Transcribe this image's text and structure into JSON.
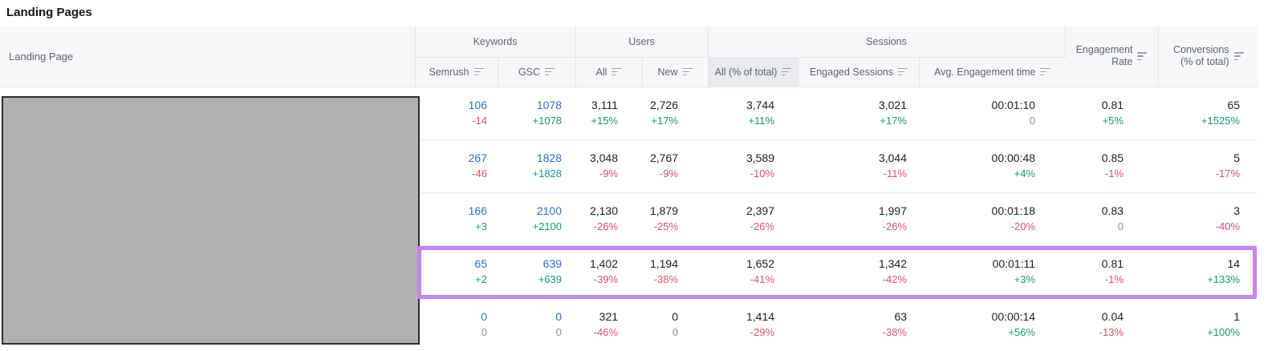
{
  "page": {
    "title": "Landing Pages"
  },
  "colors": {
    "link_blue": "#2d6ee0",
    "positive_green": "#17997e",
    "negative_red": "#e14f6d",
    "neutral_gray": "#8d939c",
    "highlight_purple": "#c385f3",
    "header_bg": "#f7f8fa",
    "selected_header_bg": "#e8eaef",
    "redaction_gray": "#b1b1b1"
  },
  "header": {
    "landing_page": "Landing Page",
    "groups": {
      "keywords": "Keywords",
      "users": "Users",
      "sessions": "Sessions"
    },
    "subcols": {
      "semrush": "Semrush",
      "gsc": "GSC",
      "users_all": "All",
      "users_new": "New",
      "sessions_all": "All (% of total)",
      "engaged": "Engaged Sessions",
      "avg_time": "Avg. Engagement time"
    },
    "engagement_rate": {
      "line1": "Engagement",
      "line2": "Rate"
    },
    "conversions": {
      "line1": "Conversions",
      "line2": "(% of total)"
    },
    "sorted_column": "All (% of total)"
  },
  "table": {
    "column_keys": [
      "semrush",
      "gsc",
      "users_all",
      "users_new",
      "sessions_all",
      "engaged",
      "avg_time",
      "rate",
      "conv"
    ],
    "rows": [
      {
        "highlighted": false,
        "cells": [
          {
            "value": "106",
            "delta": "-14",
            "value_style": "link",
            "delta_style": "neg"
          },
          {
            "value": "1078",
            "delta": "+1078",
            "value_style": "link",
            "delta_style": "pos"
          },
          {
            "value": "3,111",
            "delta": "+15%",
            "delta_style": "pos"
          },
          {
            "value": "2,726",
            "delta": "+17%",
            "delta_style": "pos"
          },
          {
            "value": "3,744",
            "delta": "+11%",
            "delta_style": "pos"
          },
          {
            "value": "3,021",
            "delta": "+17%",
            "delta_style": "pos"
          },
          {
            "value": "00:01:10",
            "delta": "0",
            "delta_style": "neutral"
          },
          {
            "value": "0.81",
            "delta": "+5%",
            "delta_style": "pos"
          },
          {
            "value": "65",
            "delta": "+1525%",
            "delta_style": "pos"
          }
        ]
      },
      {
        "highlighted": false,
        "cells": [
          {
            "value": "267",
            "delta": "-46",
            "value_style": "link",
            "delta_style": "neg"
          },
          {
            "value": "1828",
            "delta": "+1828",
            "value_style": "link",
            "delta_style": "pos"
          },
          {
            "value": "3,048",
            "delta": "-9%",
            "delta_style": "neg"
          },
          {
            "value": "2,767",
            "delta": "-9%",
            "delta_style": "neg"
          },
          {
            "value": "3,589",
            "delta": "-10%",
            "delta_style": "neg"
          },
          {
            "value": "3,044",
            "delta": "-11%",
            "delta_style": "neg"
          },
          {
            "value": "00:00:48",
            "delta": "+4%",
            "delta_style": "pos"
          },
          {
            "value": "0.85",
            "delta": "-1%",
            "delta_style": "neg"
          },
          {
            "value": "5",
            "delta": "-17%",
            "delta_style": "neg"
          }
        ]
      },
      {
        "highlighted": false,
        "cells": [
          {
            "value": "166",
            "delta": "+3",
            "value_style": "link",
            "delta_style": "pos"
          },
          {
            "value": "2100",
            "delta": "+2100",
            "value_style": "link",
            "delta_style": "pos"
          },
          {
            "value": "2,130",
            "delta": "-26%",
            "delta_style": "neg"
          },
          {
            "value": "1,879",
            "delta": "-25%",
            "delta_style": "neg"
          },
          {
            "value": "2,397",
            "delta": "-26%",
            "delta_style": "neg"
          },
          {
            "value": "1,997",
            "delta": "-26%",
            "delta_style": "neg"
          },
          {
            "value": "00:01:18",
            "delta": "-20%",
            "delta_style": "neg"
          },
          {
            "value": "0.83",
            "delta": "0",
            "delta_style": "neutral"
          },
          {
            "value": "3",
            "delta": "-40%",
            "delta_style": "neg"
          }
        ]
      },
      {
        "highlighted": true,
        "cells": [
          {
            "value": "65",
            "delta": "+2",
            "value_style": "link",
            "delta_style": "pos"
          },
          {
            "value": "639",
            "delta": "+639",
            "value_style": "link",
            "delta_style": "pos"
          },
          {
            "value": "1,402",
            "delta": "-39%",
            "delta_style": "neg"
          },
          {
            "value": "1,194",
            "delta": "-38%",
            "delta_style": "neg"
          },
          {
            "value": "1,652",
            "delta": "-41%",
            "delta_style": "neg"
          },
          {
            "value": "1,342",
            "delta": "-42%",
            "delta_style": "neg"
          },
          {
            "value": "00:01:11",
            "delta": "+3%",
            "delta_style": "pos"
          },
          {
            "value": "0.81",
            "delta": "-1%",
            "delta_style": "neg"
          },
          {
            "value": "14",
            "delta": "+133%",
            "delta_style": "pos"
          }
        ]
      },
      {
        "highlighted": false,
        "cells": [
          {
            "value": "0",
            "delta": "0",
            "value_style": "link",
            "delta_style": "neutral"
          },
          {
            "value": "0",
            "delta": "0",
            "value_style": "link",
            "delta_style": "neutral"
          },
          {
            "value": "321",
            "delta": "-46%",
            "delta_style": "neg"
          },
          {
            "value": "0",
            "delta": "0",
            "delta_style": "neutral"
          },
          {
            "value": "1,414",
            "delta": "-29%",
            "delta_style": "neg"
          },
          {
            "value": "63",
            "delta": "-38%",
            "delta_style": "neg"
          },
          {
            "value": "00:00:14",
            "delta": "+56%",
            "delta_style": "pos"
          },
          {
            "value": "0.04",
            "delta": "-13%",
            "delta_style": "neg"
          },
          {
            "value": "1",
            "delta": "+100%",
            "delta_style": "pos"
          }
        ]
      }
    ]
  }
}
